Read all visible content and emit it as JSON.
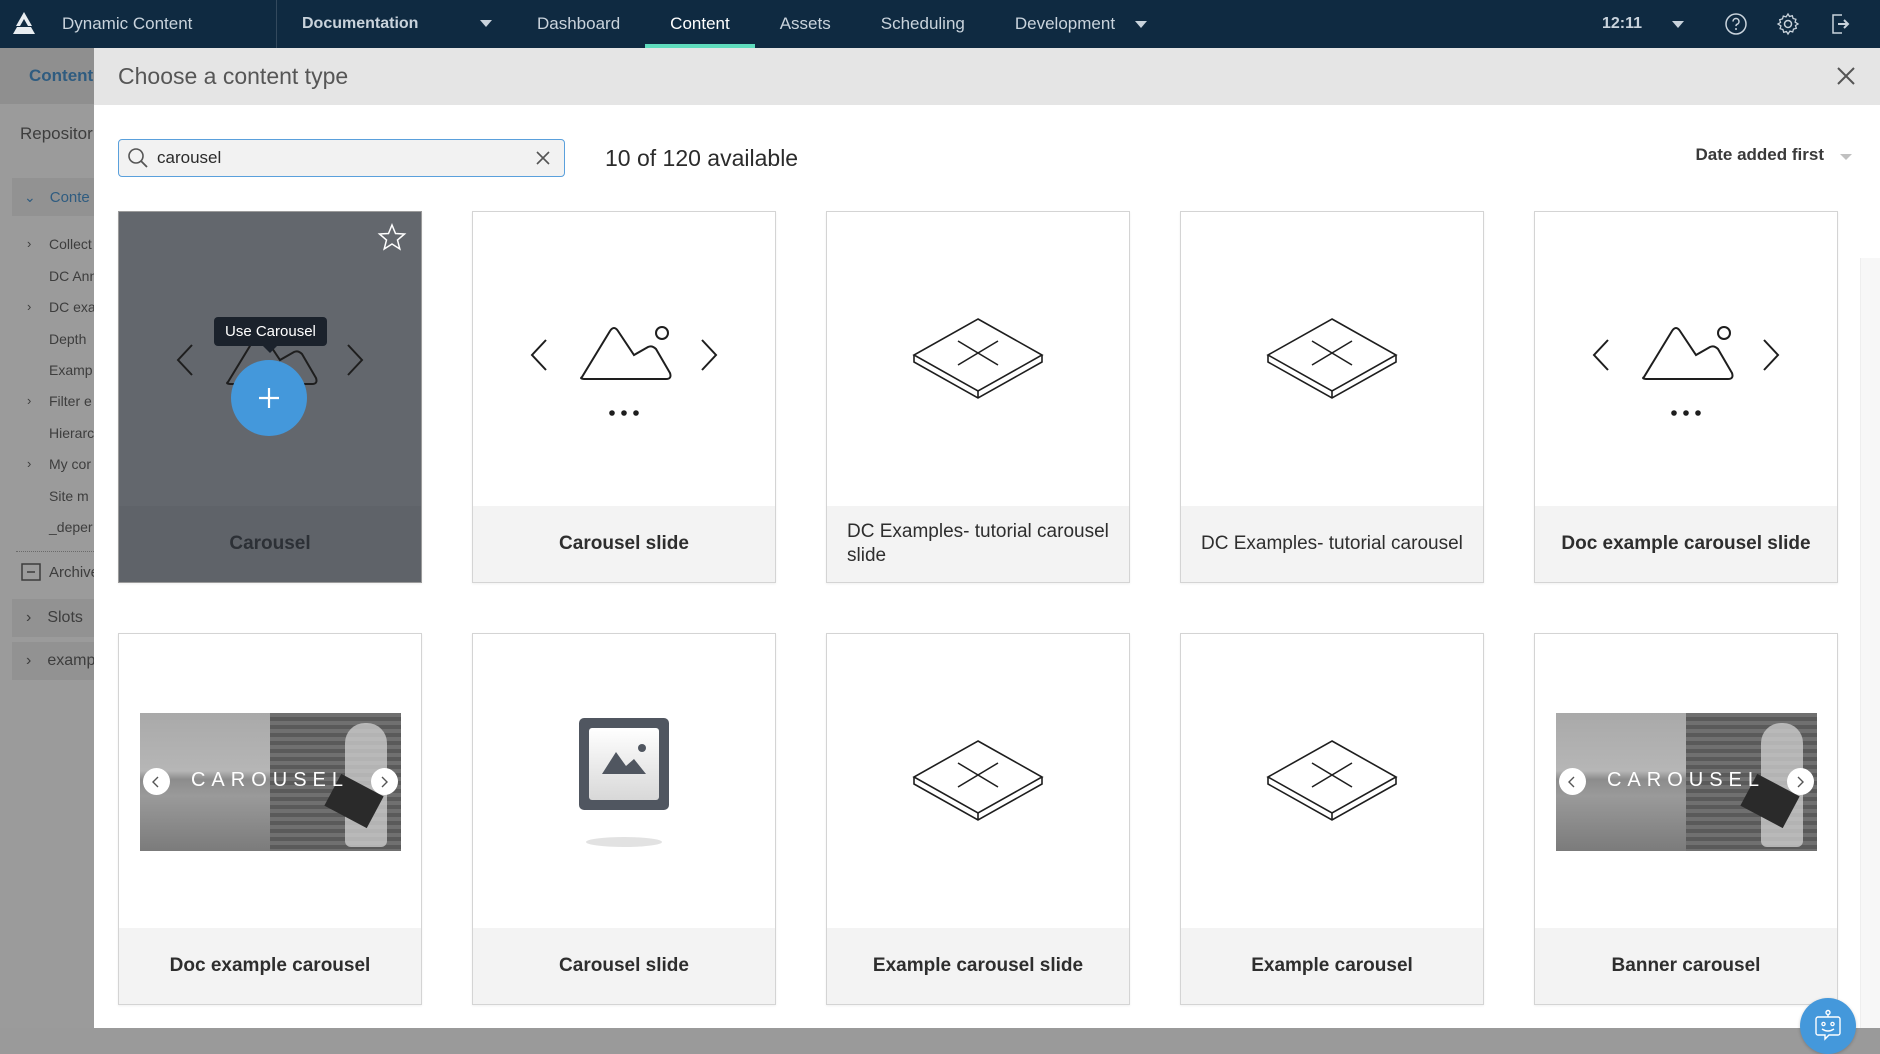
{
  "topnav": {
    "app_name": "Dynamic Content",
    "hub": "Documentation",
    "tabs": [
      {
        "label": "Dashboard",
        "active": false
      },
      {
        "label": "Content",
        "active": true
      },
      {
        "label": "Assets",
        "active": false
      },
      {
        "label": "Scheduling",
        "active": false
      },
      {
        "label": "Development",
        "active": false
      }
    ],
    "clock": "12:11",
    "icons": [
      "help-icon",
      "gear-icon",
      "logout-icon"
    ],
    "accent_color": "#5fdcbd",
    "background_color": "#0f2a41"
  },
  "background_app": {
    "breadcrumb": "Content",
    "repositories_label": "Repositor",
    "section_label": "Conte",
    "tree_items": [
      {
        "label": "Collect",
        "expandable": true
      },
      {
        "label": "DC Ann",
        "expandable": false
      },
      {
        "label": "DC exa",
        "expandable": true
      },
      {
        "label": "Depth",
        "expandable": false
      },
      {
        "label": "Examp",
        "expandable": false
      },
      {
        "label": "Filter e",
        "expandable": true
      },
      {
        "label": "Hierarc",
        "expandable": false
      },
      {
        "label": "My cor",
        "expandable": true
      },
      {
        "label": "Site m",
        "expandable": false
      },
      {
        "label": "_deper",
        "expandable": false
      }
    ],
    "archive_label": "Archive",
    "slots_label": "Slots",
    "example_label": "examp"
  },
  "modal": {
    "title": "Choose a content type",
    "search": {
      "value": "carousel",
      "placeholder": "Search"
    },
    "count_text": "10 of 120 available",
    "sort_label": "Date added first",
    "hover_tooltip": "Use Carousel",
    "fab_color": "#4498db",
    "cards": [
      {
        "label": "Carousel",
        "icon": "carousel-icon",
        "hovered": true
      },
      {
        "label": "Carousel slide",
        "icon": "carousel-icon"
      },
      {
        "label": "DC Examples- tutorial carousel slide",
        "icon": "content-type-placeholder-icon"
      },
      {
        "label": "DC Examples- tutorial carousel",
        "icon": "content-type-placeholder-icon"
      },
      {
        "label": "Doc example carousel slide",
        "icon": "carousel-icon"
      },
      {
        "label": "Doc example carousel",
        "icon": "carousel-photo-thumbnail",
        "photo_text": "CAROUSEL"
      },
      {
        "label": "Carousel slide",
        "icon": "image-placeholder-icon"
      },
      {
        "label": "Example carousel slide",
        "icon": "content-type-placeholder-icon"
      },
      {
        "label": "Example carousel",
        "icon": "content-type-placeholder-icon"
      },
      {
        "label": "Banner carousel",
        "icon": "carousel-photo-thumbnail",
        "photo_text": "CAROUSEL"
      }
    ]
  }
}
